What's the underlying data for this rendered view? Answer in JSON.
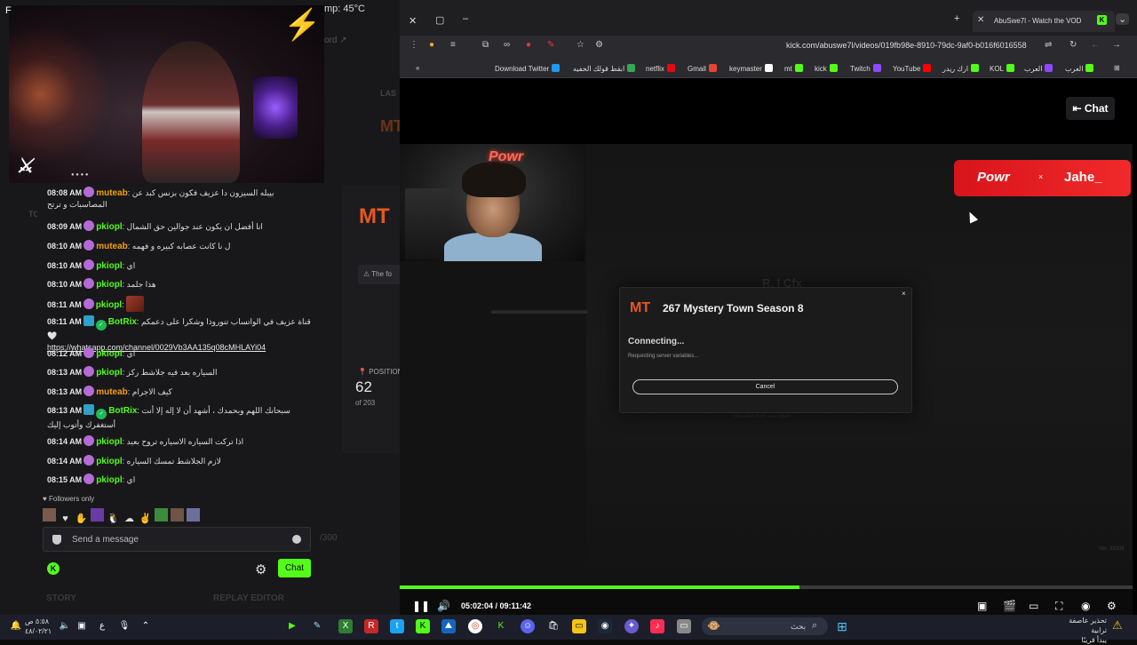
{
  "left_panel": {
    "temperature": "mp: 45°C",
    "corner_letter": "F",
    "bg_cord": "cord",
    "bg_to": "TO",
    "bg_las": "LAS",
    "bg_notice": "The fo",
    "bg_position_label": "POSITION",
    "bg_position_value": "62",
    "bg_position_of": "of 203",
    "bg_count": "/300",
    "story_label": "STORY",
    "replay_label": "REPLAY EDITOR"
  },
  "chat": {
    "messages": [
      {
        "time": "08:08 AM",
        "user": "muteab",
        "text": "بيبله السيزون دا عزيف فكون بزنس كبد عن المصاسبات و ترتح"
      },
      {
        "time": "08:09 AM",
        "user": "pkiopl",
        "text": "انا أفضل ان يكون عند جوالين حق الشمال"
      },
      {
        "time": "08:10 AM",
        "user": "muteab",
        "text": "ل نا كانت عصابه كبيره و فهمه"
      },
      {
        "time": "08:10 AM",
        "user": "pkiopl",
        "text": "اي"
      },
      {
        "time": "08:10 AM",
        "user": "pkiopl",
        "text": "هذا جلمد"
      },
      {
        "time": "08:11 AM",
        "user": "pkiopl",
        "text": ""
      },
      {
        "time": "08:11 AM",
        "user": "BotRix",
        "text": "قناة عزيف في الواتساب تنوروذا وشكرا على دعمكم 🤍",
        "link": "https://whatsapp.com/channel/0029Vb3AA135q08cMHLAYi04"
      },
      {
        "time": "08:12 AM",
        "user": "pkiopl",
        "text": "اي"
      },
      {
        "time": "08:13 AM",
        "user": "pkiopl",
        "text": "السياره بعد فيه جلاشط ركز"
      },
      {
        "time": "08:13 AM",
        "user": "muteab",
        "text": "كيف الاجرام"
      },
      {
        "time": "08:13 AM",
        "user": "BotRix",
        "text": "سبحانك اللهم وبحمدك ، أشهد أن لا إله إلا أنت أستغفرك وأتوب إليك"
      },
      {
        "time": "08:14 AM",
        "user": "pkiopl",
        "text": "اذا تركت السياره الاسياره تروح بعيد"
      },
      {
        "time": "08:14 AM",
        "user": "pkiopl",
        "text": "لازم الجلاشط تمسك السياره"
      },
      {
        "time": "08:15 AM",
        "user": "pkiopl",
        "text": "اي"
      }
    ],
    "followers_only": "Followers only",
    "input_placeholder": "Send a message",
    "send_label": "Chat"
  },
  "browser": {
    "tab_title": "AbuSwe7l - Watch the VOD",
    "url": "kick.com/abuswe7l/videos/019fb98e-8910-79dc-9af0-b016f6016558",
    "bookmarks": [
      {
        "label": "Download Twitter",
        "color": "#1d9bf0"
      },
      {
        "label": "ابقط قولك الخفيه",
        "color": "#34a853"
      },
      {
        "label": "netflix",
        "color": "#e50914"
      },
      {
        "label": "Gmail",
        "color": "#ea4335"
      },
      {
        "label": "keymaster",
        "color": "#ffffff"
      },
      {
        "label": "mt",
        "color": "#53fc18"
      },
      {
        "label": "kick",
        "color": "#53fc18"
      },
      {
        "label": "Twitch",
        "color": "#9146ff"
      },
      {
        "label": "YouTube",
        "color": "#ff0000"
      },
      {
        "label": "ارك ريدر",
        "color": "#53fc18"
      },
      {
        "label": "KOL",
        "color": "#53fc18"
      },
      {
        "label": "العرب",
        "color": "#9146ff"
      },
      {
        "label": "العرب",
        "color": "#53fc18"
      }
    ],
    "chat_toggle_label": "Chat"
  },
  "video": {
    "sponsor_left": "Powr",
    "sponsor_x": "×",
    "sponsor_right": "Jahe_",
    "facecam_neon": "Powr",
    "ghost_cfx": "R. | Cfx",
    "ghost_skip": "Skip and don't ask again",
    "ghost_version": "Ver. 33206",
    "dialog": {
      "logo": "MT",
      "title": "267 Mystery Town Season 8",
      "status": "Connecting...",
      "substatus": "Requesting server variables...",
      "cancel_label": "Cancel",
      "close": "×"
    },
    "current_time": "05:02:04",
    "duration": "09:11:42",
    "time_display": "05:02:04 / 09:11:42",
    "progress": 0.546
  },
  "taskbar": {
    "clock_time": "٥:٥٨ ص",
    "clock_date": "٤٨/٠٢/٢١",
    "search_label": "بحث",
    "alert_title": "تحذير عاصفة ترابية",
    "alert_sub": "يبدأ قريبًا"
  }
}
